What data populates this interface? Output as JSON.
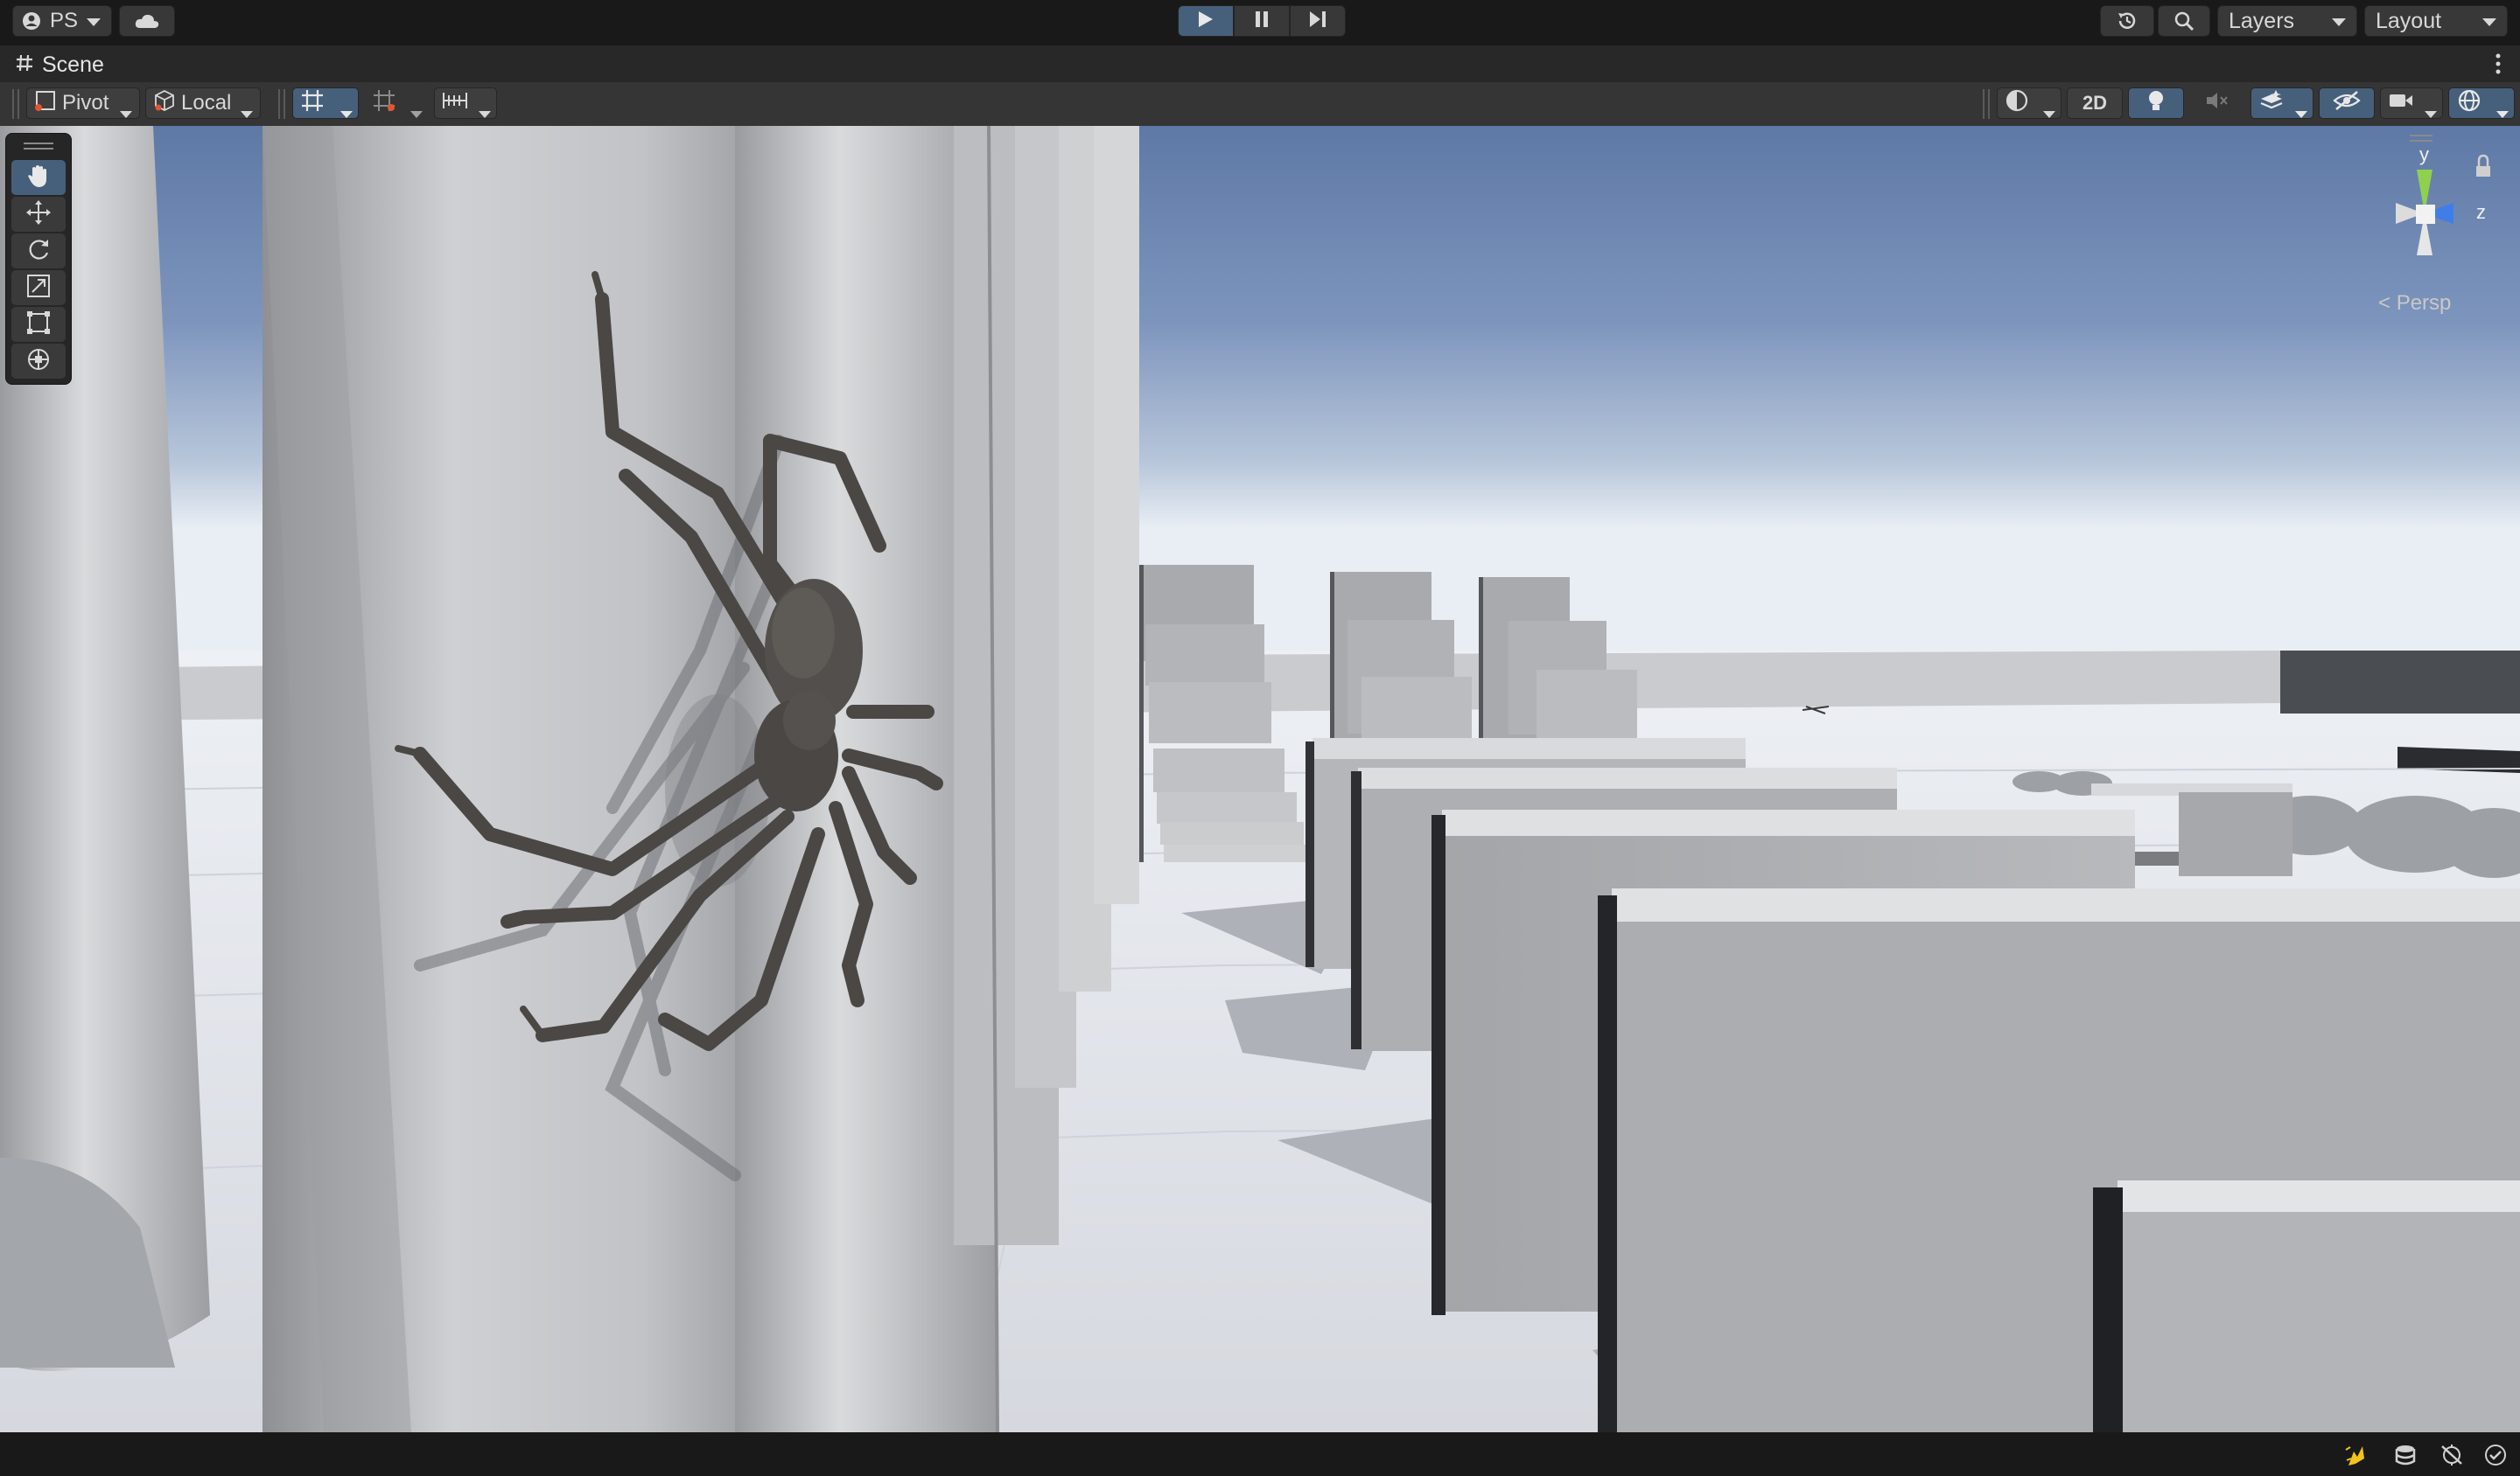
{
  "topbar": {
    "account_label": "PS",
    "layers_label": "Layers",
    "layout_label": "Layout"
  },
  "tab": {
    "title": "Scene"
  },
  "scene_toolbar": {
    "pivot_label": "Pivot",
    "local_label": "Local",
    "mode_2d_label": "2D"
  },
  "gizmo": {
    "axis_y": "y",
    "axis_z": "z",
    "projection_label": "Persp"
  },
  "colors": {
    "accent": "#46607c",
    "axis_y": "#8fd14f",
    "axis_z": "#3f7ee8"
  }
}
